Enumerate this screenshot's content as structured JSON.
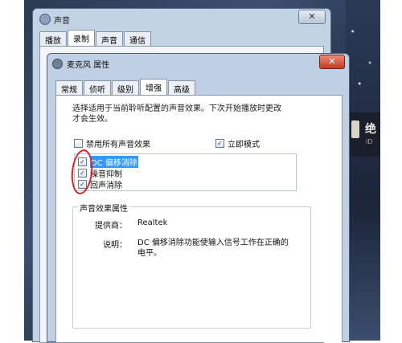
{
  "back_window": {
    "title": "声音",
    "close_label": "✕",
    "tabs": [
      "播放",
      "录制",
      "声音",
      "通信"
    ],
    "active_tab": 1
  },
  "front_window": {
    "title": "麦克风 属性",
    "close_label": "✕",
    "tabs": [
      "常规",
      "侦听",
      "级别",
      "增强",
      "高级"
    ],
    "active_tab": 3,
    "description": "选择适用于当前聆听配置的声音效果。下次开始播放时更改才会生效。",
    "disable_all": {
      "label": "禁用所有声音效果",
      "checked": false
    },
    "immediate_mode": {
      "label": "立即模式",
      "checked": true
    },
    "effects": [
      {
        "label": "DC 偏移消除",
        "checked": true,
        "selected": true
      },
      {
        "label": "噪音抑制",
        "checked": true,
        "selected": false
      },
      {
        "label": "回声消除",
        "checked": true,
        "selected": false
      }
    ],
    "properties": {
      "group_title": "声音效果属性",
      "provider_label": "提供商：",
      "provider_value": "Realtek",
      "description_label": "说明：",
      "description_value": "DC 偏移消除功能使输入信号工作在正确的电平。"
    }
  },
  "side_panel": {
    "title": "绝",
    "sub": "ID"
  },
  "colors": {
    "annotation_red": "#d2232a",
    "selection_blue": "#3399ff"
  }
}
